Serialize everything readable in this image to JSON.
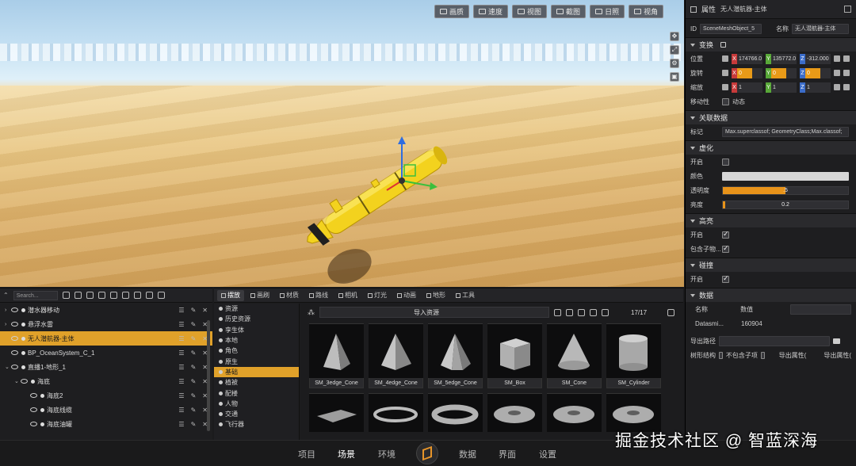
{
  "viewport": {
    "toolbar": [
      "画质",
      "速度",
      "视图",
      "截图",
      "日照",
      "视角"
    ],
    "side_icons": [
      "move-icon",
      "zoom-icon",
      "settings-icon",
      "camera-icon"
    ]
  },
  "properties": {
    "header": {
      "title": "属性",
      "subtitle": "无人潜航器-主体"
    },
    "id_label": "ID",
    "id_value": "SceneMeshObject_5",
    "name_label": "名称",
    "name_value": "无人潜航器-主体",
    "transform": {
      "title": "变换",
      "position_label": "位置",
      "position": [
        "174766.0",
        "135772.0",
        "-312.000"
      ],
      "rotation_label": "旋转",
      "rotation": [
        "0",
        "0",
        "0"
      ],
      "scale_label": "缩放",
      "scale": [
        "1",
        "1",
        "1"
      ],
      "mobility_label": "移动性",
      "mobility_value": "动态"
    },
    "linked": {
      "title": "关联数据",
      "tag_label": "标记",
      "tag_value": "Max.superclassof; GeometryClass;Max.classof;"
    },
    "virtual": {
      "title": "虚化",
      "enable_label": "开启",
      "color_label": "颜色",
      "opacity_label": "透明度",
      "opacity_value": ".5",
      "opacity_fill": 0.5,
      "brightness_label": "亮度",
      "brightness_value": "0.2",
      "brightness_fill": 0.02
    },
    "highlight": {
      "title": "高亮",
      "enable_label": "开启",
      "include_children_label": "包含子物..."
    },
    "collision": {
      "title": "碰撞",
      "enable_label": "开启"
    },
    "data": {
      "title": "数据",
      "name_label": "名称",
      "name_value": "数值",
      "datasmith_label": "Datasmi...",
      "datasmith_value": "160904",
      "export_path_label": "导出路径",
      "tree_label": "树形结构",
      "no_children_label": "不包含子项",
      "export_attr_1": "导出属性(",
      "export_attr_2": "导出属性("
    }
  },
  "outliner": {
    "search_placeholder": "Search...",
    "rows": [
      {
        "label": "潜水器移动",
        "indent": 0,
        "arrow": "›",
        "selected": false
      },
      {
        "label": "悬浮水雷",
        "indent": 0,
        "arrow": "›",
        "selected": false
      },
      {
        "label": "无人潜航器-主体",
        "indent": 0,
        "arrow": "",
        "selected": true
      },
      {
        "label": "BP_OceanSystem_C_1",
        "indent": 0,
        "arrow": "",
        "selected": false
      },
      {
        "label": "直播1-地形_1",
        "indent": 0,
        "arrow": "⌄",
        "selected": false
      },
      {
        "label": "海底",
        "indent": 1,
        "arrow": "⌄",
        "selected": false
      },
      {
        "label": "海底2",
        "indent": 2,
        "arrow": "",
        "selected": false
      },
      {
        "label": "海底线缆",
        "indent": 2,
        "arrow": "",
        "selected": false
      },
      {
        "label": "海底油罐",
        "indent": 2,
        "arrow": "",
        "selected": false
      }
    ]
  },
  "browser": {
    "tabs": [
      {
        "label": "摆放",
        "active": true
      },
      {
        "label": "画刷",
        "active": false
      },
      {
        "label": "材质",
        "active": false
      },
      {
        "label": "路线",
        "active": false
      },
      {
        "label": "相机",
        "active": false
      },
      {
        "label": "灯光",
        "active": false
      },
      {
        "label": "动画",
        "active": false
      },
      {
        "label": "地形",
        "active": false
      },
      {
        "label": "工具",
        "active": false
      }
    ],
    "categories": [
      {
        "label": "资源",
        "selected": false
      },
      {
        "label": "历史资源",
        "selected": false
      },
      {
        "label": "孪生体",
        "selected": false
      },
      {
        "label": "本地",
        "selected": false
      },
      {
        "label": "角色",
        "selected": false
      },
      {
        "label": "原生",
        "selected": false
      },
      {
        "label": "基础",
        "selected": true
      },
      {
        "label": "植被",
        "selected": false
      },
      {
        "label": "配楼",
        "selected": false
      },
      {
        "label": "人物",
        "selected": false
      },
      {
        "label": "交通",
        "selected": false
      },
      {
        "label": "飞行器",
        "selected": false
      }
    ],
    "path_label": "导入资源",
    "count": "17/17",
    "assets": [
      {
        "name": "SM_3edge_Cone",
        "shape": "pyramid3"
      },
      {
        "name": "SM_4edge_Cone",
        "shape": "pyramid4"
      },
      {
        "name": "SM_5edge_Cone",
        "shape": "pyramid5"
      },
      {
        "name": "SM_Box",
        "shape": "box"
      },
      {
        "name": "SM_Cone",
        "shape": "cone"
      },
      {
        "name": "SM_Cylinder",
        "shape": "cylinder"
      },
      {
        "name": "",
        "shape": "plane"
      },
      {
        "name": "",
        "shape": "torus-thin"
      },
      {
        "name": "",
        "shape": "torus"
      },
      {
        "name": "",
        "shape": "torus-fat"
      },
      {
        "name": "",
        "shape": "torus-fat"
      },
      {
        "name": "",
        "shape": "torus-fat"
      }
    ]
  },
  "bottom_nav": {
    "items": [
      {
        "label": "项目",
        "active": false
      },
      {
        "label": "场景",
        "active": true
      },
      {
        "label": "环境",
        "active": false
      },
      {
        "label": "数据",
        "active": false
      },
      {
        "label": "界面",
        "active": false
      },
      {
        "label": "设置",
        "active": false
      }
    ]
  },
  "watermark": "掘金技术社区 @ 智蓝深海",
  "colors": {
    "accent": "#e0a12a",
    "submarine": "#f3d21e",
    "panel": "#1e1e20"
  }
}
